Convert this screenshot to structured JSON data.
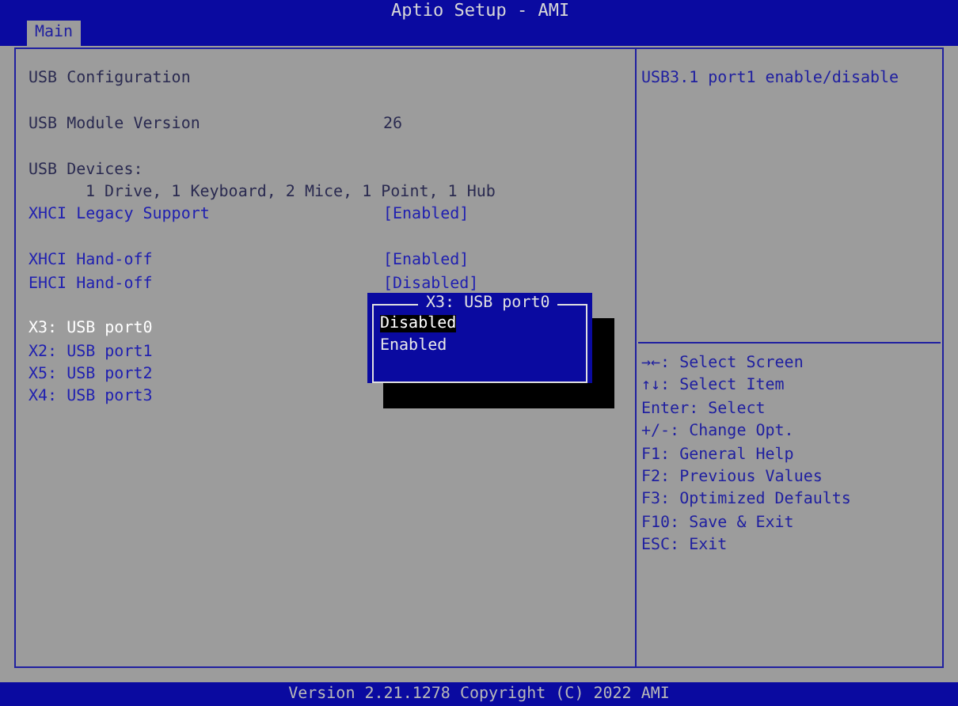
{
  "window": {
    "title": "Aptio Setup - AMI"
  },
  "tabs": [
    {
      "label": "Main",
      "selected": true
    }
  ],
  "sections": [
    {
      "items": [
        {
          "kind": "heading",
          "label": "USB Configuration"
        }
      ]
    },
    {
      "items": [
        {
          "kind": "info",
          "label": "USB Module Version",
          "value": "26"
        }
      ]
    },
    {
      "items": [
        {
          "kind": "heading",
          "label": "USB Devices:"
        },
        {
          "kind": "text",
          "label": "1 Drive, 1 Keyboard, 2 Mice, 1 Point, 1 Hub"
        },
        {
          "kind": "option",
          "label": "XHCI Legacy Support",
          "value": "[Enabled]",
          "selected": false
        }
      ]
    },
    {
      "items": [
        {
          "kind": "option",
          "label": "XHCI Hand-off",
          "value": "[Enabled]",
          "selected": false
        },
        {
          "kind": "option",
          "label": "EHCI Hand-off",
          "value": "[Disabled]",
          "selected": false
        }
      ]
    },
    {
      "items": [
        {
          "kind": "option",
          "label": "X3: USB port0",
          "selected": true
        },
        {
          "kind": "option",
          "label": "X2: USB port1",
          "selected": false
        },
        {
          "kind": "option",
          "label": "X5: USB port2",
          "selected": false
        },
        {
          "kind": "option",
          "label": "X4: USB port3",
          "selected": false
        }
      ]
    }
  ],
  "popup": {
    "title": "X3: USB port0",
    "options": [
      {
        "label": "Disabled",
        "selected": true
      },
      {
        "label": "Enabled",
        "selected": false
      }
    ]
  },
  "help": "USB3.1 port1 enable/disable",
  "keys": [
    "→←: Select Screen",
    "↑↓: Select Item",
    "Enter: Select",
    "+/-: Change Opt.",
    "F1: General Help",
    "F2: Previous Values",
    "F3: Optimized Defaults",
    "F10: Save & Exit",
    "ESC: Exit"
  ],
  "footer": "Version 2.21.1278 Copyright (C) 2022 AMI"
}
